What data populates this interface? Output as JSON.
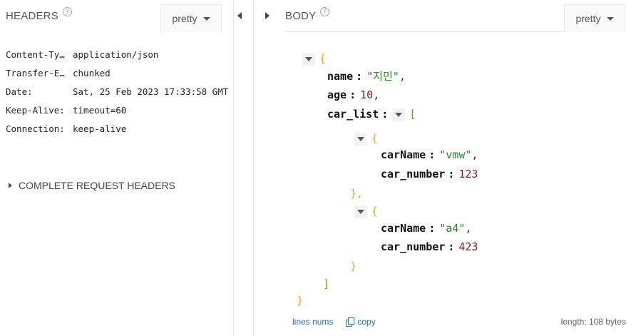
{
  "headers_panel": {
    "title": "HEADERS",
    "help_icon": "?",
    "format_select": "pretty",
    "rows": [
      {
        "key": "Content-Ty…",
        "value": "application/json"
      },
      {
        "key": "Transfer-E…",
        "value": "chunked"
      },
      {
        "key": "Date:",
        "value": "Sat, 25 Feb 2023 17:33:58 GMT"
      },
      {
        "key": "Keep-Alive:",
        "value": "timeout=60"
      },
      {
        "key": "Connection:",
        "value": "keep-alive"
      }
    ],
    "complete_request_label": "COMPLETE REQUEST HEADERS"
  },
  "body_panel": {
    "title": "BODY",
    "help_icon": "?",
    "format_select": "pretty",
    "json": {
      "open_root": "{",
      "name_key": "name",
      "name_value": "\"지민\"",
      "age_key": "age",
      "age_value": "10",
      "car_list_key": "car_list",
      "open_array": "[",
      "item0_open": "{",
      "item0_carName_key": "carName",
      "item0_carName_value": "\"vmw\"",
      "item0_car_number_key": "car_number",
      "item0_car_number_value": "123",
      "item0_close": "},",
      "item1_open": "{",
      "item1_carName_key": "carName",
      "item1_carName_value": "\"a4\"",
      "item1_car_number_key": "car_number",
      "item1_car_number_value": "423",
      "item1_close": "}",
      "close_array": "]",
      "close_root": "}",
      "colon": ":",
      "comma": ","
    },
    "footer": {
      "lines_nums_label": "lines nums",
      "copy_label": "copy",
      "length_label": "length: 108 bytes"
    }
  },
  "icons": {
    "collapse_left": "triangle-left-icon",
    "expand_right": "triangle-right-icon",
    "toggle": "caret-down-icon",
    "copy": "copy-icon"
  },
  "colors": {
    "link": "#2a6ebb",
    "string": "#2a8a2a",
    "number": "#8b1a1a",
    "object_brace": "#f5a623",
    "array_bracket": "#8a8a3a"
  }
}
